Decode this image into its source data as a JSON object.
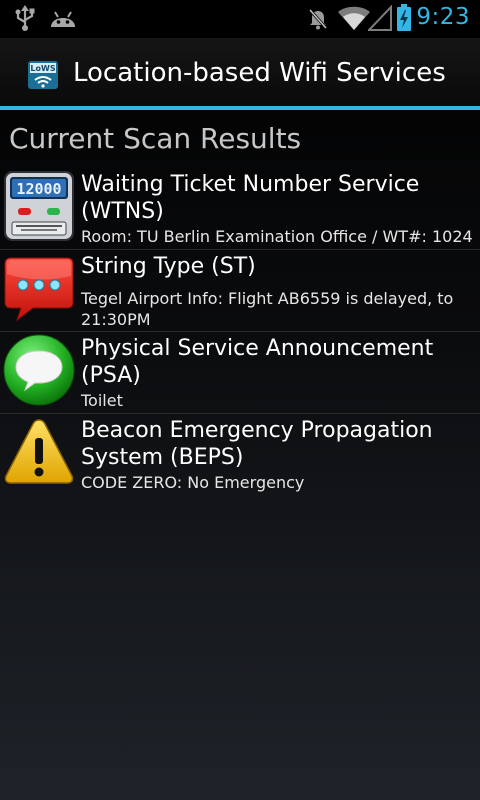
{
  "status_bar": {
    "time": "9:23",
    "icons": [
      "usb-icon",
      "android-icon",
      "mute-icon",
      "wifi-icon",
      "signal-icon",
      "battery-icon"
    ],
    "accent_color": "#33b5e5"
  },
  "action_bar": {
    "app_icon_text": "LoWS",
    "title": "Location-based Wifi Services"
  },
  "section": {
    "title": "Current Scan Results"
  },
  "results": [
    {
      "icon": "ticket-counter-icon",
      "icon_text": "12000",
      "title_line1": "Waiting Ticket Number Service",
      "title_line2": "(WTNS)",
      "subtitle_line1": "Room: TU Berlin Examination Office / WT#: 1024",
      "subtitle_line2": ""
    },
    {
      "icon": "chat-bubble-red-icon",
      "title_line1": "String Type (ST)",
      "title_line2": "",
      "subtitle_line1": "Tegel Airport Info: Flight AB6559 is delayed, to",
      "subtitle_line2": "21:30PM"
    },
    {
      "icon": "speech-bubble-green-icon",
      "title_line1": "Physical Service Announcement (PSA)",
      "title_line2": "",
      "subtitle_line1": "Toilet",
      "subtitle_line2": ""
    },
    {
      "icon": "warning-icon",
      "title_line1": "Beacon Emergency Propagation",
      "title_line2": "System (BEPS)",
      "subtitle_line1": "CODE ZERO: No Emergency",
      "subtitle_line2": ""
    }
  ]
}
